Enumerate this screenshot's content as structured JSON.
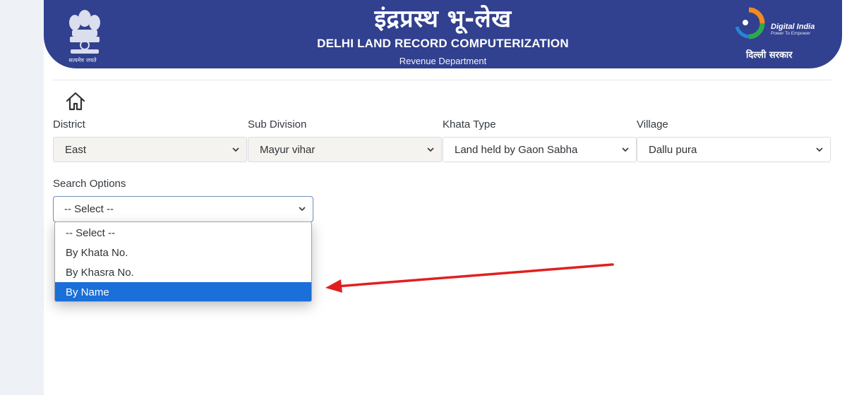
{
  "header": {
    "hindi_title": "इंद्रप्रस्थ भू-लेख",
    "english_title": "DELHI LAND RECORD COMPUTERIZATION",
    "department": "Revenue Department",
    "emblem_motto": "सत्यमेव जयते",
    "digital_india": "Digital India",
    "digital_india_tagline": "Power To Empower",
    "govt_label": "दिल्ली सरकार"
  },
  "filters": {
    "district": {
      "label": "District",
      "value": "East"
    },
    "sub_division": {
      "label": "Sub Division",
      "value": "Mayur vihar"
    },
    "khata_type": {
      "label": "Khata Type",
      "value": "Land held by Gaon Sabha"
    },
    "village": {
      "label": "Village",
      "value": "Dallu pura"
    }
  },
  "search_options": {
    "label": "Search Options",
    "value": "-- Select --",
    "options": [
      "-- Select --",
      "By Khata No.",
      "By Khasra No.",
      "By Name"
    ],
    "highlighted": "By Name"
  },
  "colors": {
    "banner": "#31408f",
    "highlight": "#1a6fd8",
    "arrow": "#e02020"
  }
}
